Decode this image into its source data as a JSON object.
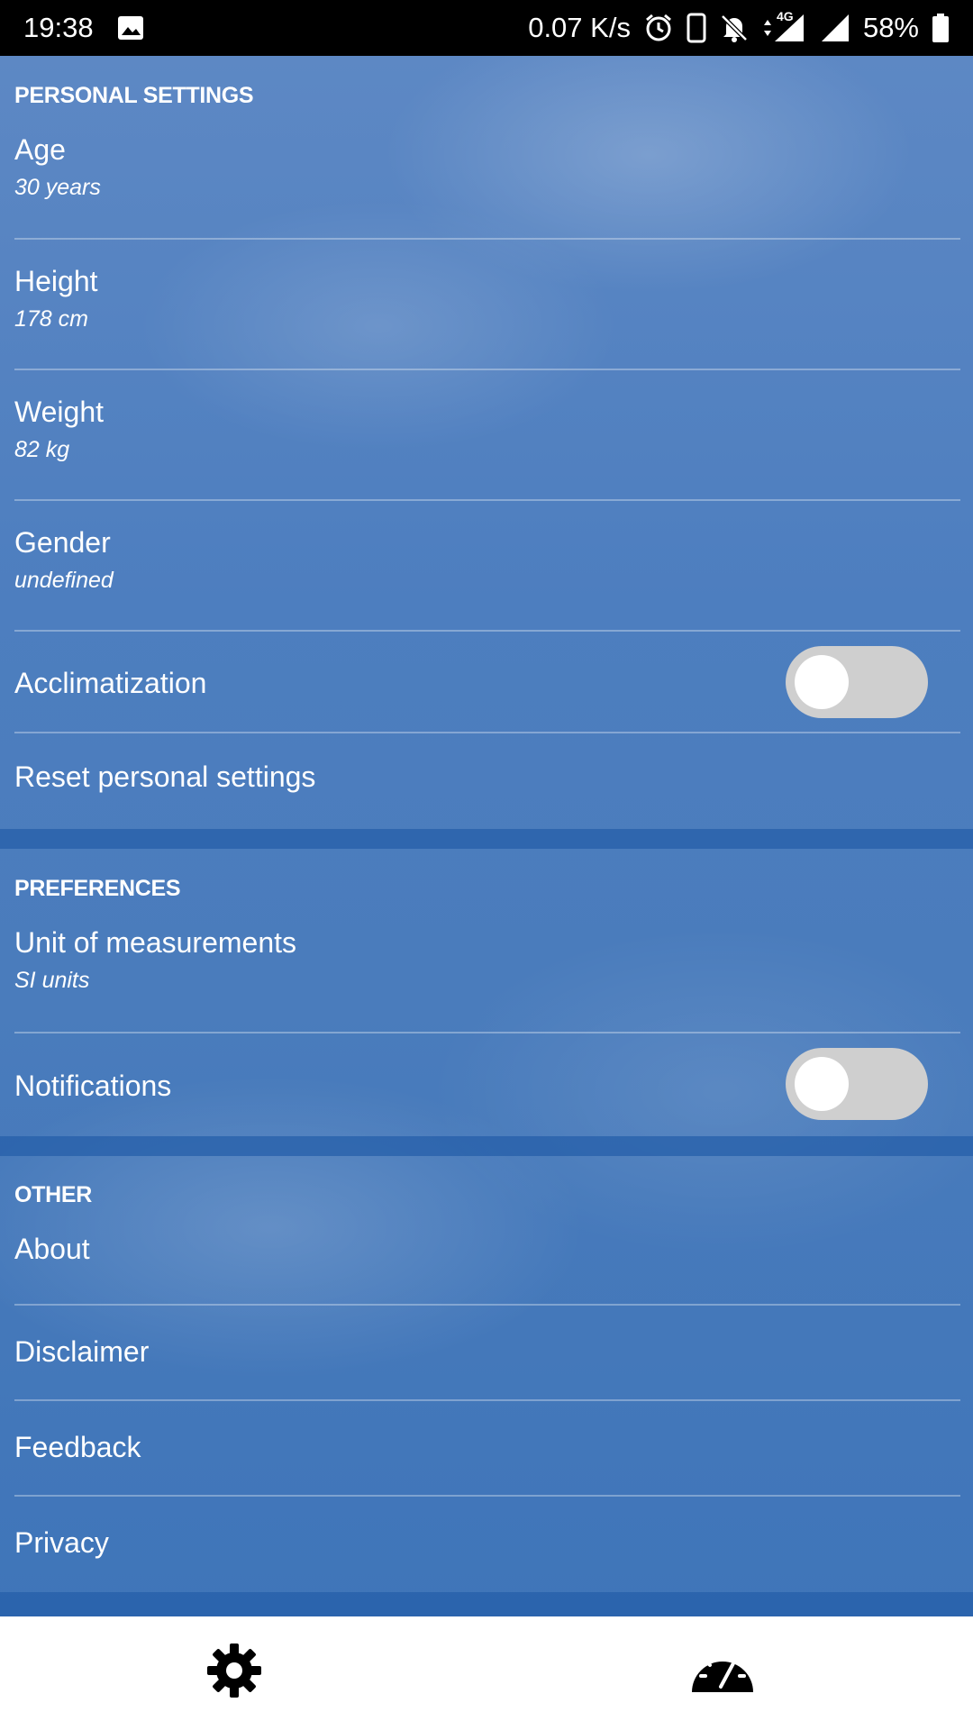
{
  "status_bar": {
    "time": "19:38",
    "network_speed": "0.07 K/s",
    "network_type": "4G",
    "battery": "58%",
    "icons": [
      "image-icon",
      "alarm-icon",
      "phone-icon",
      "bell-off-icon",
      "signal-icon",
      "battery-icon"
    ]
  },
  "sections": {
    "personal": {
      "header": "PERSONAL SETTINGS",
      "age": {
        "title": "Age",
        "value": "30 years"
      },
      "height": {
        "title": "Height",
        "value": "178 cm"
      },
      "weight": {
        "title": "Weight",
        "value": "82 kg"
      },
      "gender": {
        "title": "Gender",
        "value": "undefined"
      },
      "acclimatization": {
        "title": "Acclimatization",
        "enabled": false
      },
      "reset": {
        "title": "Reset personal settings"
      }
    },
    "preferences": {
      "header": "PREFERENCES",
      "units": {
        "title": "Unit of measurements",
        "value": "SI units"
      },
      "notifications": {
        "title": "Notifications",
        "enabled": false
      }
    },
    "other": {
      "header": "OTHER",
      "about": "About",
      "disclaimer": "Disclaimer",
      "feedback": "Feedback",
      "privacy": "Privacy"
    }
  },
  "bottom_nav": {
    "items": [
      {
        "icon": "gear-icon",
        "active": true
      },
      {
        "icon": "speedometer-icon",
        "active": false
      }
    ]
  },
  "colors": {
    "background": "#4a7bbb",
    "toggle_off": "#cfcfcf",
    "text": "#ffffff"
  }
}
